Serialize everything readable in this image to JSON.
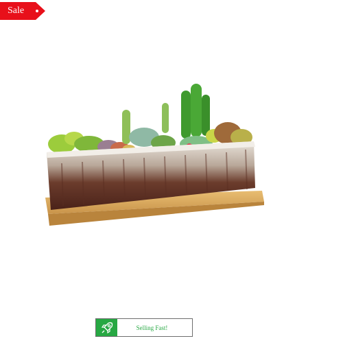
{
  "badge": {
    "label": "Sale",
    "color": "#e8101a"
  },
  "product": {
    "image": "succulent-planter-image"
  },
  "status": {
    "label": "Selling Fast!",
    "icon": "rocket-icon",
    "color": "#27a843"
  }
}
